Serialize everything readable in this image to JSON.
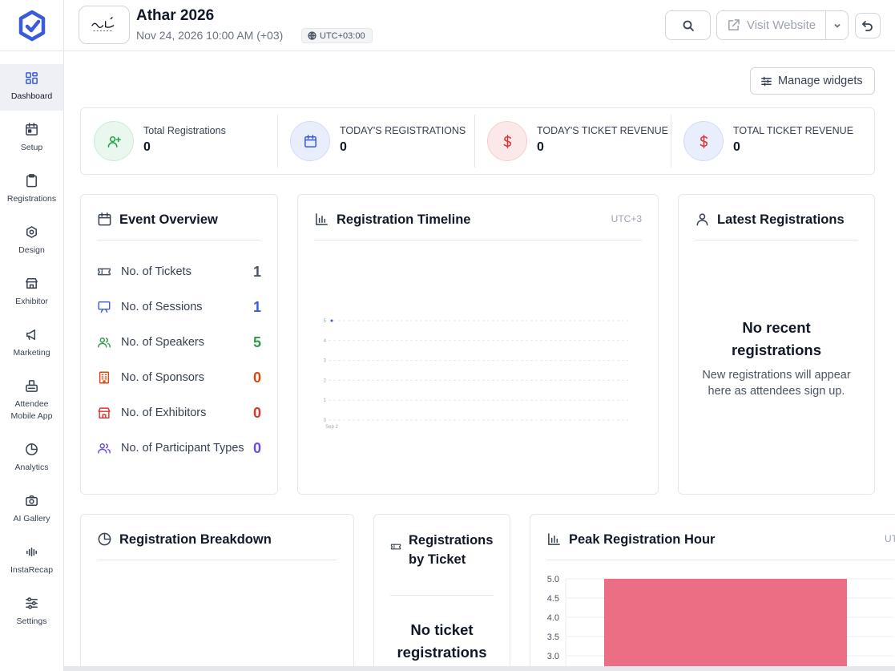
{
  "sidebar": {
    "items": [
      {
        "label": "Dashboard",
        "icon": "grid-icon"
      },
      {
        "label": "Setup",
        "icon": "calendar-setup-icon"
      },
      {
        "label": "Registrations",
        "icon": "clipboard-icon"
      },
      {
        "label": "Design",
        "icon": "palette-icon"
      },
      {
        "label": "Exhibitor",
        "icon": "store-icon"
      },
      {
        "label": "Marketing",
        "icon": "megaphone-icon"
      },
      {
        "label": "Attendee Mobile App",
        "icon": "mobile-app-icon"
      },
      {
        "label": "Analytics",
        "icon": "pie-chart-icon"
      },
      {
        "label": "AI Gallery",
        "icon": "camera-icon"
      },
      {
        "label": "InstaRecap",
        "icon": "audio-wave-icon"
      },
      {
        "label": "Settings",
        "icon": "sliders-icon"
      }
    ]
  },
  "header": {
    "title": "Athar 2026",
    "date": "Nov 24, 2026 10:00 AM (+03)",
    "timezone": "UTC+03:00",
    "visit_website": "Visit Website"
  },
  "main": {
    "manage_widgets": "Manage widgets",
    "stats": [
      {
        "label": "Total Registrations",
        "value": "0",
        "icon": "user-plus-icon",
        "color": "#22a34a",
        "bg": "#e9f7ee"
      },
      {
        "label": "TODAY'S REGISTRATIONS",
        "value": "0",
        "icon": "calendar-icon",
        "color": "#3b5bdb",
        "bg": "#e8eefb"
      },
      {
        "label": "TODAY'S TICKET REVENUE",
        "value": "0",
        "icon": "dollar-icon",
        "color": "#e03131",
        "bg": "#fbe9e9"
      },
      {
        "label": "TOTAL TICKET REVENUE",
        "value": "0",
        "icon": "dollar-icon",
        "color": "#e03131",
        "bg": "#e8eefb"
      }
    ],
    "event_overview": {
      "title": "Event Overview",
      "rows": [
        {
          "label": "No. of Tickets",
          "value": "1",
          "icon": "ticket-icon",
          "color": "#4b5563"
        },
        {
          "label": "No. of Sessions",
          "value": "1",
          "icon": "presentation-icon",
          "color": "#3b5bdb"
        },
        {
          "label": "No. of Speakers",
          "value": "5",
          "icon": "users-icon",
          "color": "#2f9e44"
        },
        {
          "label": "No. of Sponsors",
          "value": "0",
          "icon": "building-icon",
          "color": "#d9480f"
        },
        {
          "label": "No. of Exhibitors",
          "value": "0",
          "icon": "store-icon",
          "color": "#e03131"
        },
        {
          "label": "No. of Participant Types",
          "value": "0",
          "icon": "users-icon",
          "color": "#7048e8"
        }
      ]
    },
    "registration_timeline": {
      "title": "Registration Timeline",
      "timezone": "UTC+3"
    },
    "latest_registrations": {
      "title": "Latest Registrations",
      "empty_title": "No recent registrations",
      "empty_desc": "New registrations will appear here as attendees sign up."
    },
    "registration_breakdown": {
      "title": "Registration Breakdown"
    },
    "registrations_by_ticket": {
      "title": "Registrations by Ticket",
      "empty_title": "No ticket registrations"
    },
    "peak_registration_hour": {
      "title": "Peak Registration Hour",
      "timezone": "UT"
    }
  },
  "chart_data": [
    {
      "type": "line",
      "x": [
        "Sep 2"
      ],
      "series": [
        {
          "values": [
            5
          ]
        }
      ],
      "ylim": [
        0,
        5
      ],
      "yticks": [
        0,
        1,
        2,
        3,
        4,
        5
      ],
      "grid": true,
      "color": "#3b5bdb"
    },
    {
      "type": "bar",
      "categories": [
        ""
      ],
      "values": [
        5
      ],
      "ylim": [
        3.0,
        5.0
      ],
      "yticks": [
        "5.0",
        "4.5",
        "4.0",
        "3.5",
        "3.0"
      ],
      "grid": true,
      "color": "#ec6e85"
    }
  ]
}
